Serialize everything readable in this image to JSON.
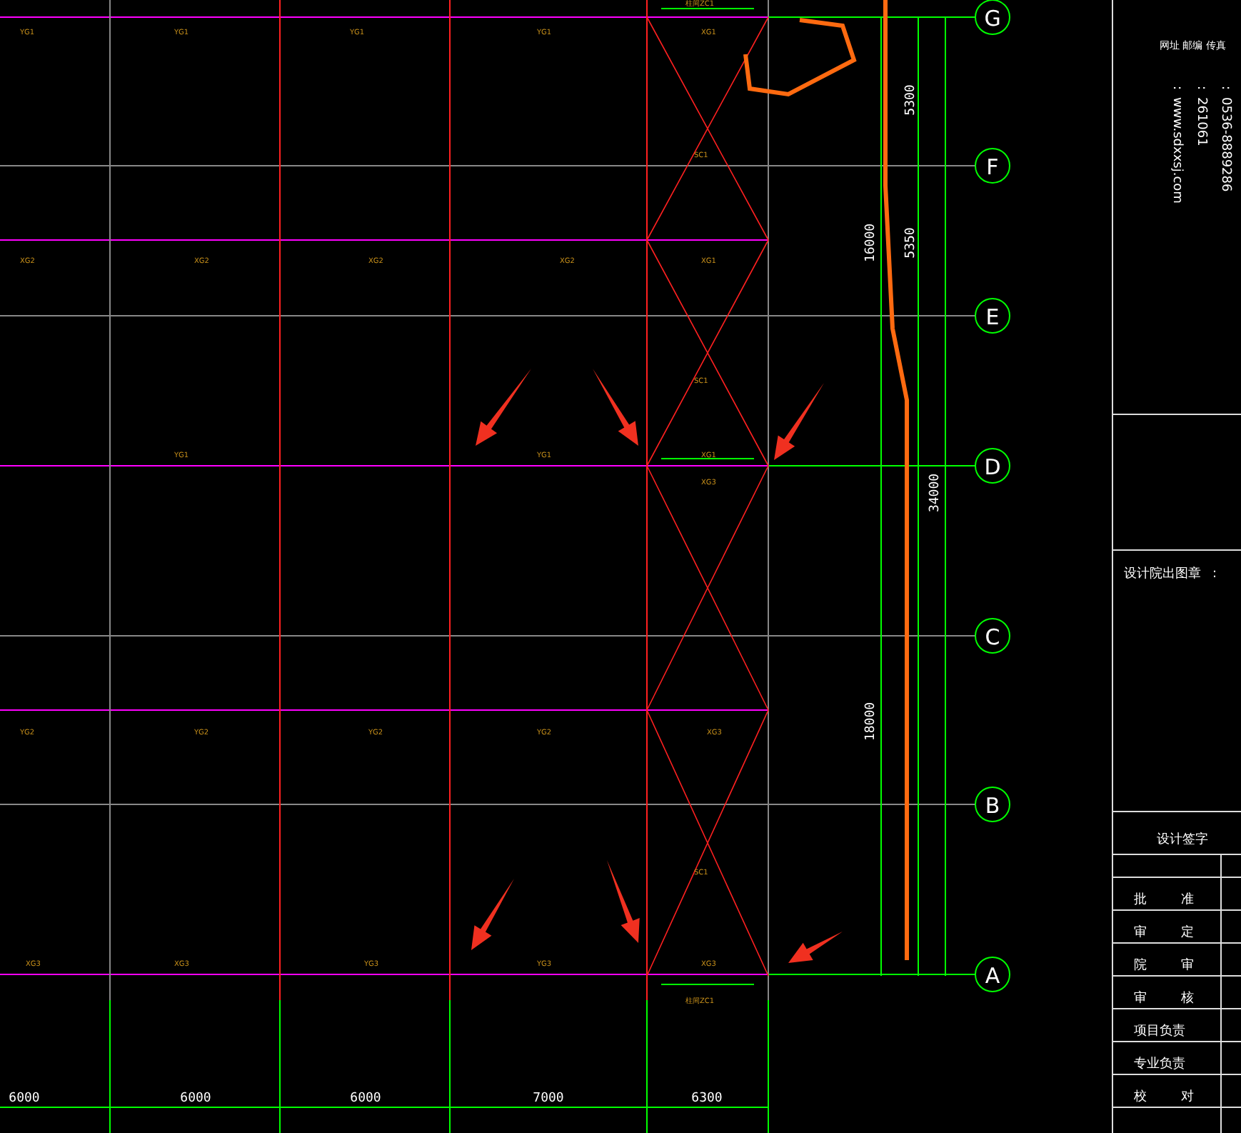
{
  "grid_axes": [
    {
      "label": "G"
    },
    {
      "label": "F"
    },
    {
      "label": "E"
    },
    {
      "label": "D"
    },
    {
      "label": "C"
    },
    {
      "label": "B"
    },
    {
      "label": "A"
    }
  ],
  "member_rows": [
    {
      "labels": [
        "YG1",
        "YG1",
        "YG1",
        "YG1",
        "XG1"
      ]
    },
    {
      "labels": [
        "XG2",
        "XG2",
        "XG2",
        "XG2",
        "XG1"
      ]
    },
    {
      "labels": [
        "YG1",
        "YG1",
        "XG1"
      ]
    },
    {
      "labels": [
        "XG3"
      ]
    },
    {
      "labels": [
        "YG2",
        "YG2",
        "YG2",
        "YG2",
        "XG3"
      ]
    },
    {
      "labels": [
        "XG3",
        "XG3",
        "YG3",
        "YG3",
        "XG3"
      ]
    }
  ],
  "bracing_labels": [
    "SC1",
    "SC1",
    "SC1"
  ],
  "column_braces": [
    "柱间ZC1",
    "柱间ZC1"
  ],
  "bottom_dims": [
    {
      "text": "6000"
    },
    {
      "text": "6000"
    },
    {
      "text": "6000"
    },
    {
      "text": "7000"
    },
    {
      "text": "6300"
    }
  ],
  "right_dims": {
    "upper": [
      "5300",
      "5350"
    ],
    "span_upper": "16000",
    "total": "34000",
    "span_lower": "18000"
  },
  "title_block": {
    "header": "网址 邮编 传真",
    "contacts": [
      {
        "colon": ":",
        "value": "0536-8889286"
      },
      {
        "colon": ":",
        "value": "261061"
      },
      {
        "colon": ":",
        "value": "www.sdxxsj.com"
      }
    ],
    "stamp_label": "设计院出图章",
    "stamp_colon": ":",
    "signature_title": "设计签字",
    "signature_rows": [
      {
        "parts": [
          "批",
          "准"
        ]
      },
      {
        "parts": [
          "审",
          "定"
        ]
      },
      {
        "parts": [
          "院",
          "审"
        ]
      },
      {
        "parts": [
          "审",
          "核"
        ]
      },
      {
        "parts": [
          "项目负责"
        ]
      },
      {
        "parts": [
          "专业负责"
        ]
      },
      {
        "parts": [
          "校",
          "对"
        ]
      }
    ]
  }
}
